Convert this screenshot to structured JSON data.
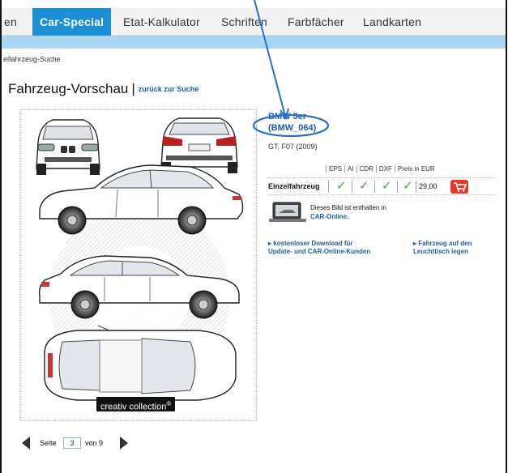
{
  "nav": {
    "items": [
      {
        "label": "en",
        "active": false
      },
      {
        "label": "Car-Special",
        "active": true
      },
      {
        "label": "Etat-Kalkulator",
        "active": false
      },
      {
        "label": "Schriften",
        "active": false
      },
      {
        "label": "Farbfächer",
        "active": false
      },
      {
        "label": "Landkarten",
        "active": false
      }
    ]
  },
  "breadcrumb": "elfahrzeug-Suche",
  "page": {
    "title": "Fahrzeug-Vorschau",
    "separator": "|",
    "back_link": "zurück zur Suche"
  },
  "preview": {
    "badge_label": "creativ collection",
    "badge_mark": "®"
  },
  "model": {
    "name": "BMW 5er",
    "code": "(BMW_064)",
    "subtitle": "GT, F07 (2009)"
  },
  "pricing": {
    "formats": [
      "EPS",
      "AI",
      "CDR",
      "DXF",
      "Preis in EUR"
    ],
    "row_label": "Einzelfahrzeug",
    "check_glyph": "✓",
    "price": "29,00"
  },
  "car_online": {
    "text": "Dieses Bild ist enthalten in",
    "link": "CAR-Online."
  },
  "links": {
    "download": [
      "kostenloser Download für",
      "Update- und CAR-Online-Kunden"
    ],
    "lighttable": [
      "Fahrzeug auf den",
      "Leuchttisch legen"
    ]
  },
  "pager": {
    "label": "Seite",
    "current": "3",
    "of": "von 9"
  },
  "colors": {
    "accent": "#1a8fd6",
    "strip": "#a9d6f2",
    "link": "#1c5ea8",
    "check": "#4ba53a",
    "cart": "#e53a26",
    "annotation": "#2a6fc9"
  }
}
